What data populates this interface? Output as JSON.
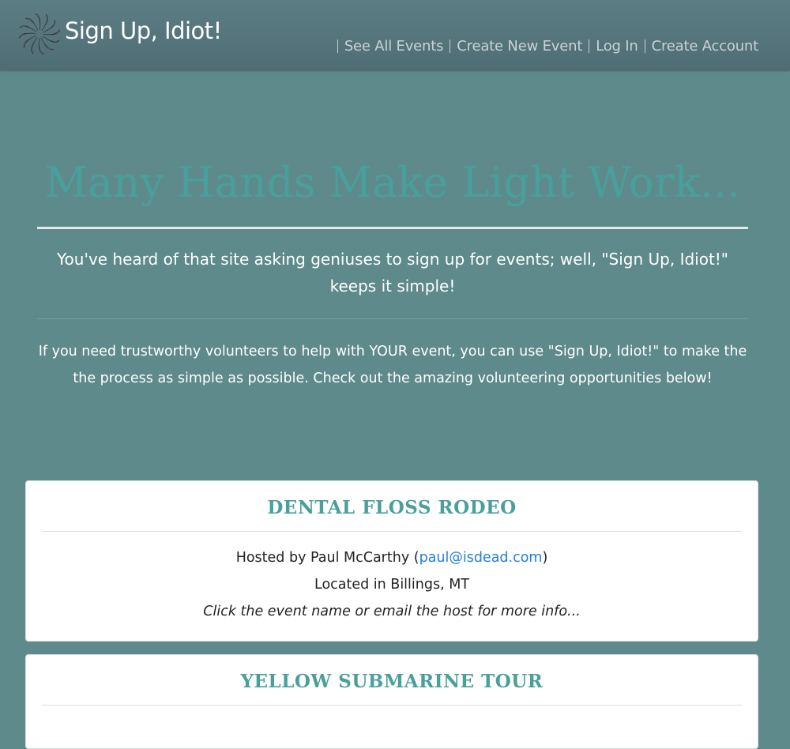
{
  "brand": {
    "name": "Sign Up, Idiot!",
    "logo_icon": "spiral-logo-icon"
  },
  "nav": {
    "links": [
      {
        "label": "See All Events"
      },
      {
        "label": "Create New Event"
      },
      {
        "label": "Log In"
      },
      {
        "label": "Create Account"
      }
    ]
  },
  "hero": {
    "title": "Many Hands Make Light Work...",
    "lead": "You've heard of that site asking geniuses to sign up for events; well, \"Sign Up, Idiot!\" keeps it simple!",
    "body": "If you need trustworthy volunteers to help with YOUR event, you can use \"Sign Up, Idiot!\" to make the the process as simple as possible. Check out the amazing volunteering opportunities below!"
  },
  "events": [
    {
      "title": "DENTAL FLOSS RODEO",
      "hosted_prefix": "Hosted by Paul McCarthy (",
      "host_email": "paul@isdead.com",
      "hosted_suffix": ")",
      "location": "Located in Billings, MT",
      "note": "Click the event name or email the host for more info..."
    },
    {
      "title": "YELLOW SUBMARINE TOUR"
    }
  ],
  "colors": {
    "page_background": "#5e8a8b",
    "navbar": "#54737a",
    "accent_teal": "#48a09c",
    "link_blue": "#1f7fe0"
  }
}
